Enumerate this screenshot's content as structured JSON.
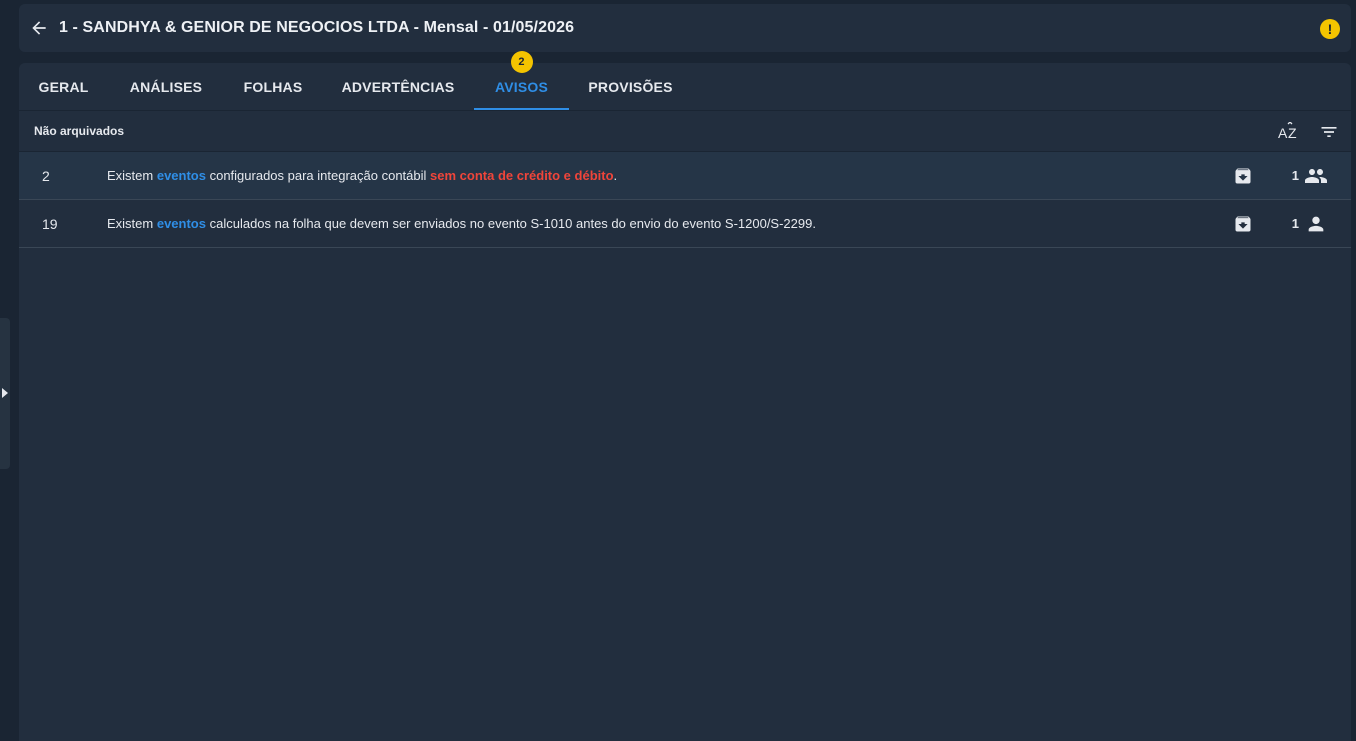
{
  "header": {
    "title": "1 - SANDHYA & GENIOR DE NEGOCIOS LTDA - Mensal - 01/05/2026",
    "alert_icon": "!"
  },
  "tabs": [
    {
      "label": "GERAL",
      "active": false
    },
    {
      "label": "ANÁLISES",
      "active": false
    },
    {
      "label": "FOLHAS",
      "active": false
    },
    {
      "label": "ADVERTÊNCIAS",
      "active": false
    },
    {
      "label": "AVISOS",
      "active": true,
      "badge": "2"
    },
    {
      "label": "PROVISÕES",
      "active": false
    }
  ],
  "section": {
    "title": "Não arquivados",
    "sort_icon": "sort-alpha-icon",
    "filter_icon": "filter-icon"
  },
  "rows": [
    {
      "code": "2",
      "text_1": "Existem ",
      "link": "eventos",
      "text_2": " configurados para integração contábil ",
      "highlight": "sem conta de crédito e débito",
      "text_3": ".",
      "count": "1",
      "icon": "group-icon"
    },
    {
      "code": "19",
      "text_1": "Existem ",
      "link": "eventos",
      "text_2": " calculados na folha que devem ser enviados no evento S-1010 antes do envio do evento S-1200/S-2299.",
      "count": "1",
      "icon": "person-icon"
    }
  ],
  "colors": {
    "accent": "#2f8ee6",
    "warning": "#f4c400",
    "danger": "#f0453a",
    "panel": "#222e3e",
    "background": "#1a2533"
  }
}
